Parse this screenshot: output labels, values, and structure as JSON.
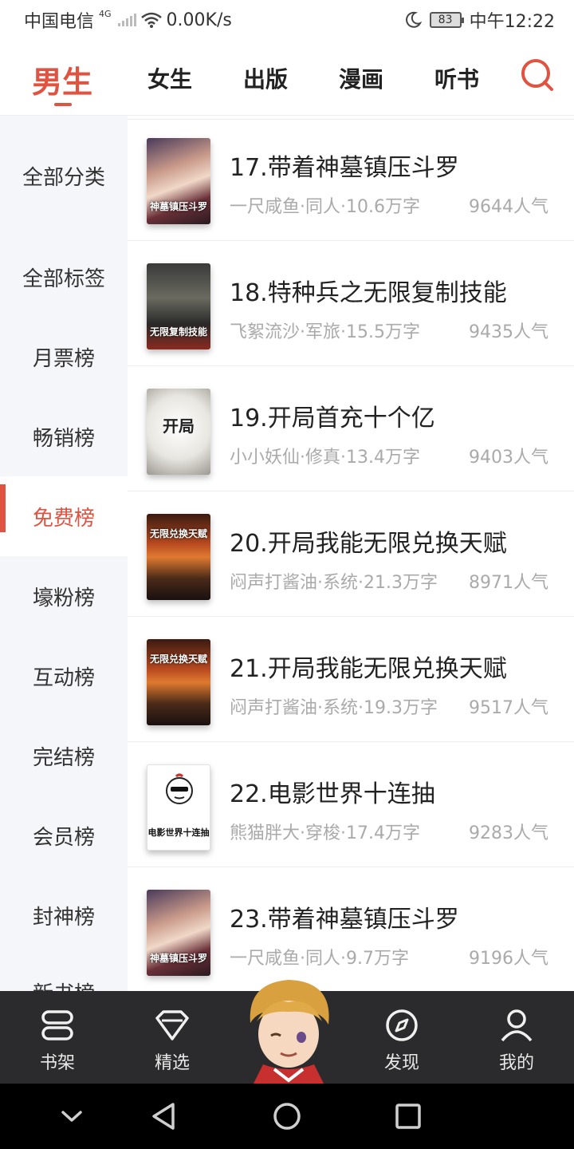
{
  "status_bar": {
    "carrier": "中国电信",
    "network": "4G",
    "speed": "0.00K/s",
    "battery": "83",
    "time": "中午12:22"
  },
  "top_tabs": [
    {
      "label": "男生",
      "active": true
    },
    {
      "label": "女生"
    },
    {
      "label": "出版"
    },
    {
      "label": "漫画"
    },
    {
      "label": "听书"
    }
  ],
  "sidebar": {
    "items": [
      {
        "label": "全部分类"
      },
      {
        "label": "全部标签"
      },
      {
        "label": "月票榜"
      },
      {
        "label": "畅销榜"
      },
      {
        "label": "免费榜",
        "active": true
      },
      {
        "label": "壕粉榜"
      },
      {
        "label": "互动榜"
      },
      {
        "label": "完结榜"
      },
      {
        "label": "会员榜"
      },
      {
        "label": "封神榜"
      },
      {
        "label": "新书榜"
      }
    ]
  },
  "books": [
    {
      "title": "17.带着神墓镇压斗罗",
      "meta": "一尺咸鱼·同人·10.6万字",
      "popularity": "9644人气",
      "cover_text": "神墓镇压斗罗",
      "cover_style": "anime"
    },
    {
      "title": "18.特种兵之无限复制技能",
      "meta": "飞絮流沙·军旅·15.5万字",
      "popularity": "9435人气",
      "cover_text": "无限复制技能",
      "cover_style": "soldier"
    },
    {
      "title": "19.开局首充十个亿",
      "meta": "小小妖仙·修真·13.4万字",
      "popularity": "9403人气",
      "cover_text": "开局",
      "cover_style": "white"
    },
    {
      "title": "20.开局我能无限兑换天赋",
      "meta": "闷声打酱油·系统·21.3万字",
      "popularity": "8971人气",
      "cover_text": "无限兑换天赋",
      "cover_style": "war"
    },
    {
      "title": "21.开局我能无限兑换天赋",
      "meta": "闷声打酱油·系统·19.3万字",
      "popularity": "9517人气",
      "cover_text": "无限兑换天赋",
      "cover_style": "war"
    },
    {
      "title": "22.电影世界十连抽",
      "meta": "熊猫胖大·穿梭·17.4万字",
      "popularity": "9283人气",
      "cover_text": "电影世界十连抽",
      "cover_style": "cartoon"
    },
    {
      "title": "23.带着神墓镇压斗罗",
      "meta": "一尺咸鱼·同人·9.7万字",
      "popularity": "9196人气",
      "cover_text": "神墓镇压斗罗",
      "cover_style": "anime"
    }
  ],
  "bottom_nav": [
    {
      "label": "书架",
      "icon": "bookshelf-icon"
    },
    {
      "label": "精选",
      "icon": "diamond-icon"
    },
    {
      "label": "发现",
      "icon": "compass-icon"
    },
    {
      "label": "我的",
      "icon": "user-icon"
    }
  ],
  "colors": {
    "accent": "#e05340",
    "sidebar_bg": "#f5f6fa",
    "nav_bg": "#2b2b2d"
  }
}
